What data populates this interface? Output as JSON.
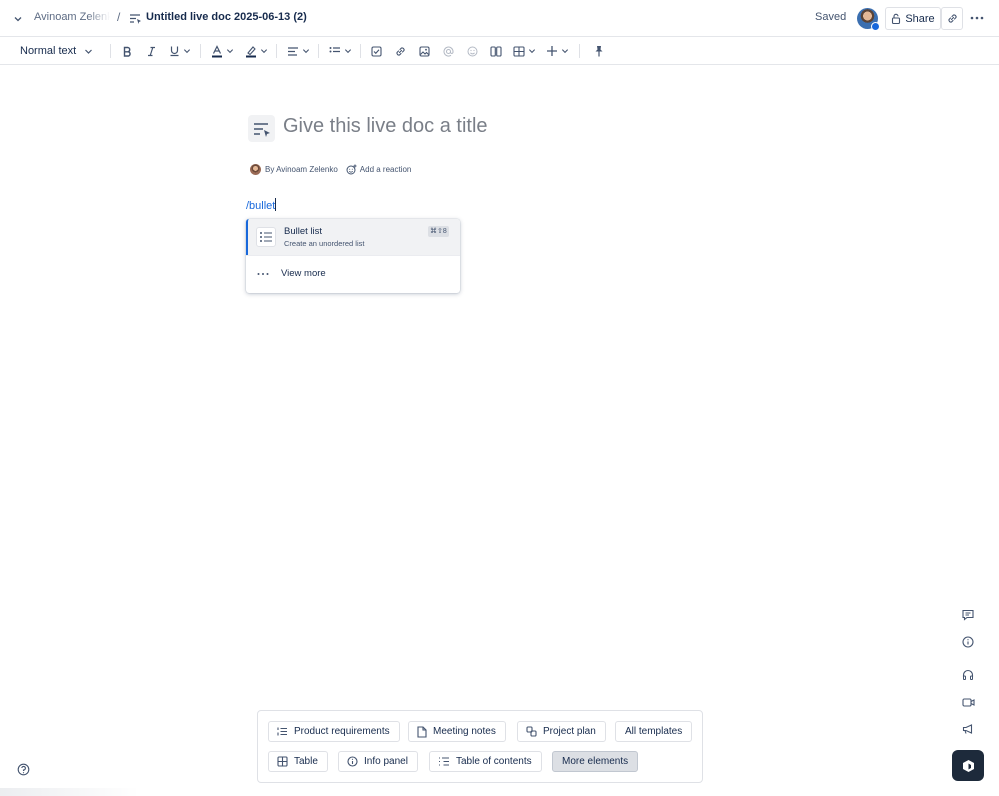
{
  "header": {
    "space_name": "Avinoam Zelenko",
    "separator": "/",
    "doc_name": "Untitled live doc 2025-06-13 (2)",
    "status": "Saved",
    "share_label": "Share"
  },
  "toolbar": {
    "text_style": "Normal text",
    "items": [
      "bold-icon",
      "italic-icon",
      "underline-icon",
      "text-color-icon",
      "highlight-icon",
      "align-icon",
      "list-icon",
      "checkbox-icon",
      "link-icon",
      "image-icon",
      "mention-icon",
      "emoji-icon",
      "layout-icon",
      "table-icon",
      "insert-icon",
      "pin-icon"
    ]
  },
  "doc": {
    "title_placeholder": "Give this live doc a title",
    "byline": "By Avinoam Zelenko",
    "reaction_label": "Add a reaction",
    "typed_text": "/bullet"
  },
  "popup": {
    "item_title": "Bullet list",
    "item_description": "Create an unordered list",
    "item_shortcut": "⌘⇧8",
    "view_more": "View more"
  },
  "templates": {
    "row1": [
      "Product requirements",
      "Meeting notes",
      "Project plan",
      "All templates"
    ],
    "row2": [
      "Table",
      "Info panel",
      "Table of contents",
      "More elements"
    ]
  },
  "colors": {
    "accent": "#1868db",
    "text": "#172b4d",
    "subtle": "#44546f"
  }
}
